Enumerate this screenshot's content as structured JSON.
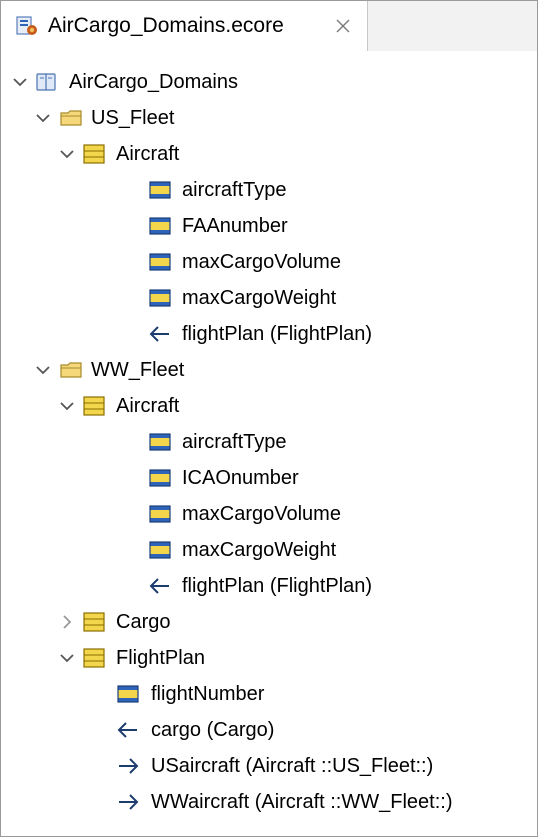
{
  "tab": {
    "title": "AirCargo_Domains.ecore",
    "close_icon": "close-icon"
  },
  "tree": {
    "root": "AirCargo_Domains",
    "us_fleet": {
      "label": "US_Fleet",
      "aircraft": {
        "label": "Aircraft",
        "attrs": [
          "aircraftType",
          "FAAnumber",
          "maxCargoVolume",
          "maxCargoWeight"
        ],
        "ref": "flightPlan (FlightPlan)"
      }
    },
    "ww_fleet": {
      "label": "WW_Fleet",
      "aircraft": {
        "label": "Aircraft",
        "attrs": [
          "aircraftType",
          "ICAOnumber",
          "maxCargoVolume",
          "maxCargoWeight"
        ],
        "ref": "flightPlan (FlightPlan)"
      }
    },
    "cargo": {
      "label": "Cargo",
      "expanded": false
    },
    "flightplan": {
      "label": "FlightPlan",
      "attr": "flightNumber",
      "ref_in": "cargo (Cargo)",
      "refs_out": [
        "USaircraft (Aircraft ::US_Fleet::)",
        "WWaircraft (Aircraft ::WW_Fleet::)"
      ]
    }
  },
  "colors": {
    "folder_fill": "#f5d87a",
    "class_fill": "#f3d64b",
    "attribute_fill": "#2d63b8",
    "frame_border": "#9a9a9a"
  }
}
